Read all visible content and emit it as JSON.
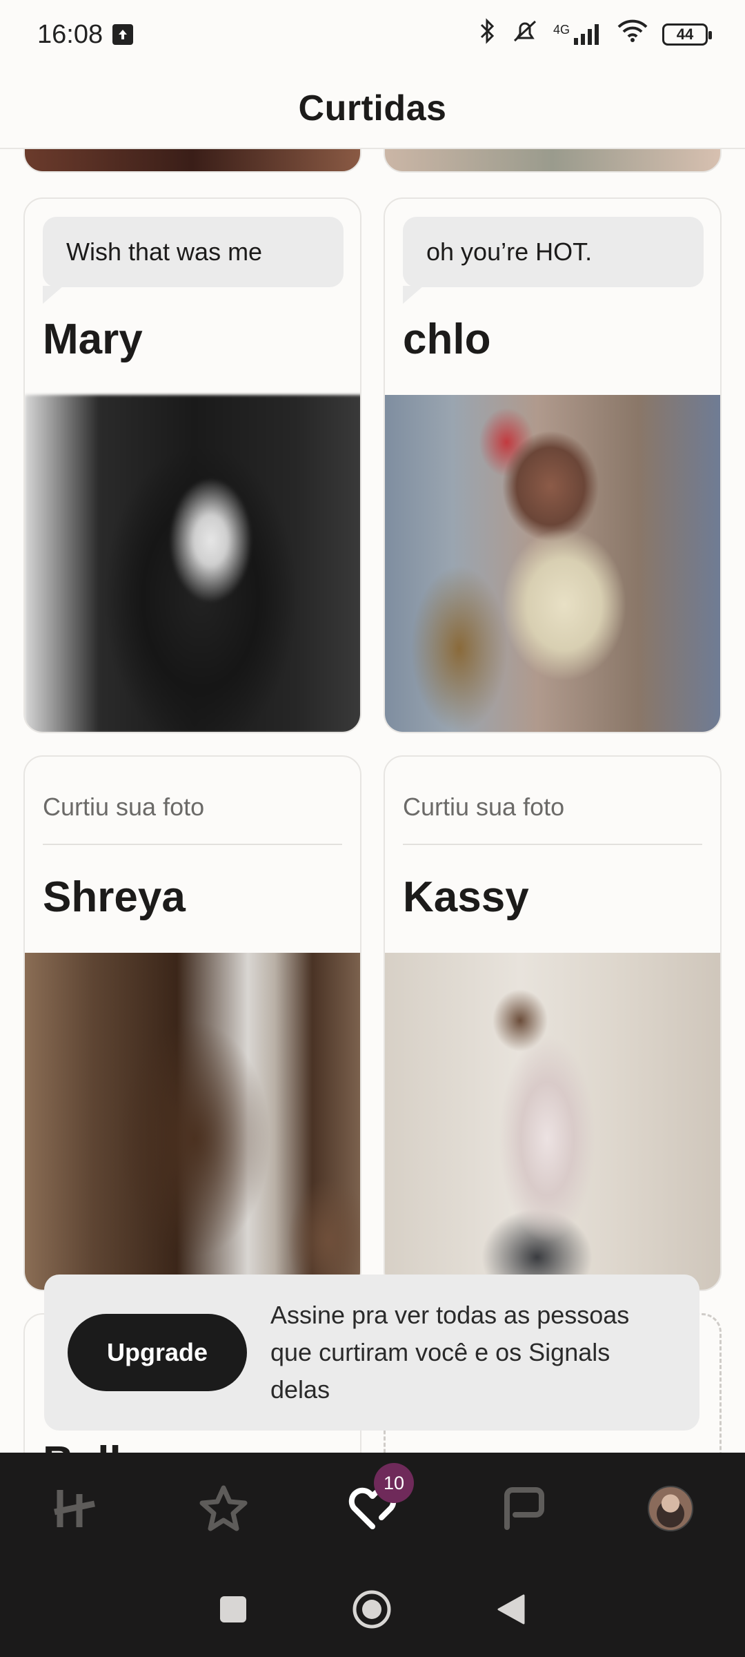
{
  "status_bar": {
    "time": "16:08",
    "network": "4G",
    "battery": "44"
  },
  "header": {
    "title": "Curtidas"
  },
  "cards": [
    {
      "type": "message",
      "message": "Wish that was me",
      "name": "Mary"
    },
    {
      "type": "message",
      "message": "oh you’re HOT.",
      "name": "chlo"
    },
    {
      "type": "photo_like",
      "subtitle": "Curtiu sua foto",
      "name": "Shreya"
    },
    {
      "type": "photo_like",
      "subtitle": "Curtiu sua foto",
      "name": "Kassy"
    },
    {
      "type": "partial",
      "name": "Bella"
    }
  ],
  "banner": {
    "button_label": "Upgrade",
    "text": "Assine pra ver todas as pessoas que curtiram você e os Signals delas"
  },
  "bottom_nav": {
    "items": [
      "home",
      "standouts",
      "likes",
      "matches",
      "profile"
    ],
    "likes_badge": "10",
    "active": "likes"
  },
  "colors": {
    "accent_badge": "#6f2a5a",
    "button": "#1b1b1b",
    "nav_bg": "#1b1a1a"
  }
}
